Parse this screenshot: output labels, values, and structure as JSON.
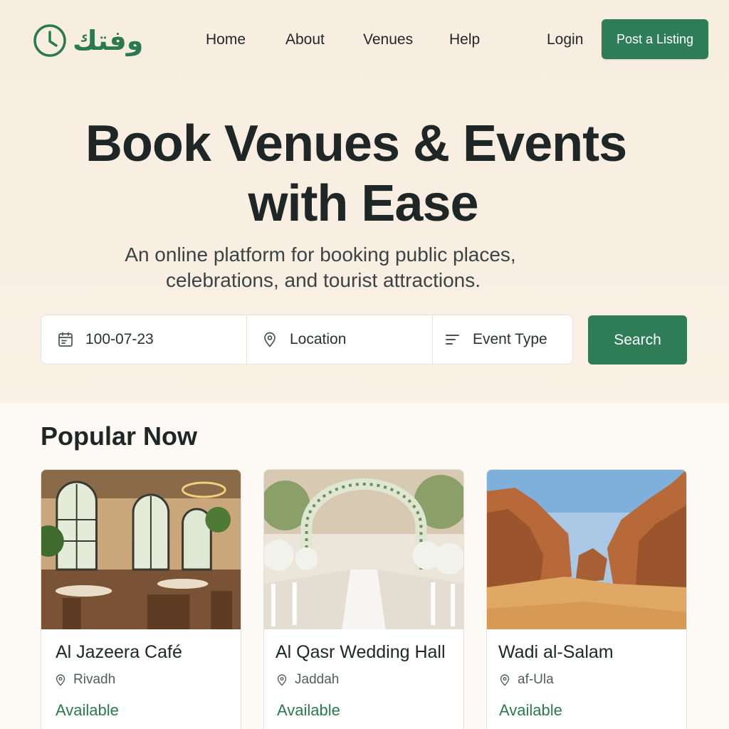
{
  "header": {
    "logo_text": "وفتك",
    "nav": [
      "Home",
      "About",
      "Venues",
      "Help"
    ],
    "login_label": "Login",
    "post_label": "Post a Listing"
  },
  "hero": {
    "title_line1": "Book Venues & Events",
    "title_line2": "with Ease",
    "subtitle_line1": "An online platform for booking public places,",
    "subtitle_line2": "celebrations, and tourist attractions."
  },
  "search": {
    "date_value": "100-07-23",
    "location_placeholder": "Location",
    "event_type_placeholder": "Event Type",
    "button_label": "Search"
  },
  "popular": {
    "title": "Popular Now",
    "cards": [
      {
        "name": "Al Jazeera Café",
        "location": "Rivadh",
        "status": "Available",
        "image": "cafe-interior"
      },
      {
        "name": "Al Qasr Wedding Hall",
        "location": "Jaddah",
        "status": "Available",
        "image": "wedding-aisle"
      },
      {
        "name": "Wadi al-Salam",
        "location": "af-Ula",
        "status": "Available",
        "image": "desert-canyon"
      }
    ]
  },
  "colors": {
    "brand_green": "#2e7d57",
    "hero_bg": "#f8ede1",
    "status_green": "#2b7a4f"
  },
  "icons": [
    "clock-logo-icon",
    "calendar-icon",
    "location-pin-icon",
    "filter-lines-icon"
  ]
}
